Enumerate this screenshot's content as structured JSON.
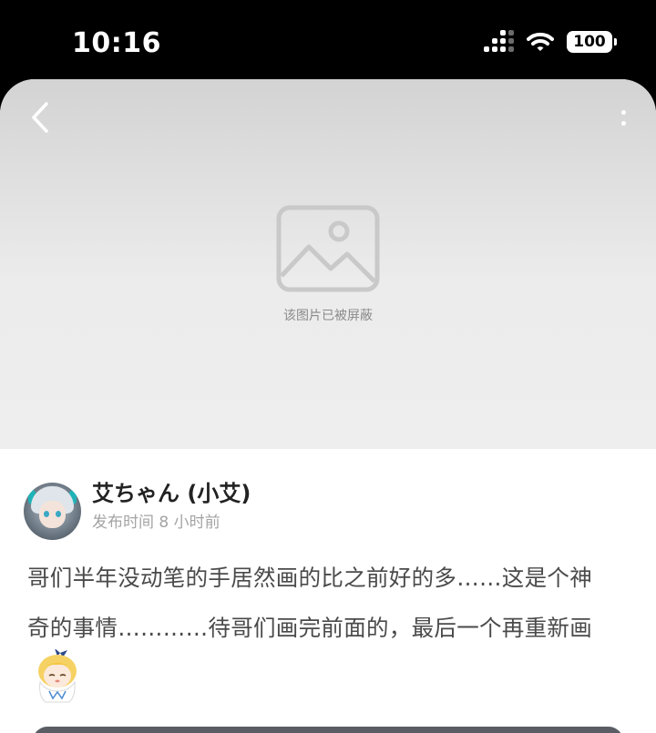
{
  "status_bar": {
    "time": "10:16",
    "battery": "100",
    "icons": [
      "cellular-signal-icon",
      "wifi-icon",
      "battery-icon"
    ]
  },
  "media": {
    "blocked_text": "该图片已被屏蔽",
    "icons": [
      "back-chevron-icon",
      "more-vertical-icon",
      "image-placeholder-icon"
    ]
  },
  "post": {
    "author_name": "艾ちゃん (小艾)",
    "meta_label": "发布时间",
    "meta_time": "8 小时前",
    "content_line1": "哥们半年没动笔的手居然画的比之前好的多……这是个神",
    "content_line2": "奇的事情…………待哥们画完前面的，最后一个再重新画",
    "sticker_icon": "anime-girl-sticker-icon"
  },
  "colors": {
    "app_background": "#ffffff",
    "status_bar_background": "#000000",
    "text_primary": "#222222",
    "text_body": "#4a4a4a",
    "text_secondary": "#a4a4a4",
    "placeholder_gray": "#c8c8c8",
    "bottom_bar": "#5a5d63"
  }
}
